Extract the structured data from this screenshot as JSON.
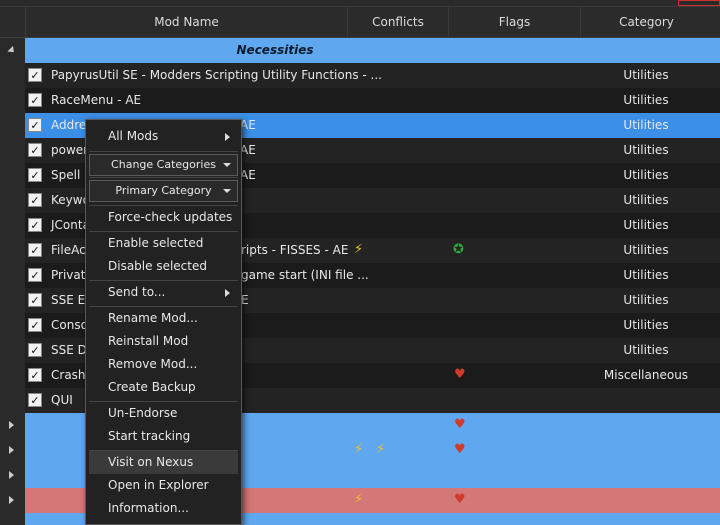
{
  "columns": {
    "mod_name": "Mod Name",
    "conflicts": "Conflicts",
    "flags": "Flags",
    "category": "Category"
  },
  "group": {
    "name": "Necessities"
  },
  "mods": [
    {
      "name": "PapyrusUtil SE - Modders Scripting Utility Functions - ...",
      "category": "Utilities"
    },
    {
      "name": "RaceMenu - AE",
      "category": "Utilities"
    },
    {
      "name": "Address Library for SKSE Plugins - AE",
      "visible_left": "Addre",
      "visible_right": "AE",
      "category": "Utilities"
    },
    {
      "name": "powerofthree's Papyrus Extender - AE",
      "visible_left": "power",
      "visible_right": "AE",
      "category": "Utilities"
    },
    {
      "name": "Spell Perk Item Distributor - AE",
      "visible_left": "Spell P",
      "visible_right": "AE",
      "category": "Utilities"
    },
    {
      "name": "Keyword Item Distributor",
      "visible_left": "Keywo",
      "visible_right": "",
      "category": "Utilities"
    },
    {
      "name": "JContainers",
      "visible_left": "JConta",
      "visible_right": "",
      "category": "Utilities"
    },
    {
      "name": "FileAccess Interface for Skyrim SE Scripts - FISSES - AE",
      "visible_left": "FileAc",
      "visible_right": "ripts - FISSES - AE",
      "category": "Utilities"
    },
    {
      "name": "Private Profile Redirector - game start (INI file ...",
      "visible_left": "Private",
      "visible_right": "game start (INI file ...",
      "category": "Utilities"
    },
    {
      "name": "SSE Engine Fixes - AE",
      "visible_left": "SSE En",
      "visible_right": "E",
      "category": "Utilities"
    },
    {
      "name": "Console Util",
      "visible_left": "Conso",
      "visible_right": "",
      "category": "Utilities"
    },
    {
      "name": "SSE Display Tweaks",
      "visible_left": "SSE Di",
      "visible_right": "",
      "category": "Utilities"
    },
    {
      "name": "Crash Logger",
      "visible_left": "Crash",
      "visible_right": "",
      "category": "Miscellaneous"
    },
    {
      "name": "QUI",
      "visible_left": "QUI",
      "visible_right": "",
      "category": ""
    }
  ],
  "context_menu": {
    "all_mods": "All Mods",
    "change_categories": "Change Categories",
    "primary_category": "Primary Category",
    "force_check": "Force-check updates",
    "enable_selected": "Enable selected",
    "disable_selected": "Disable selected",
    "send_to": "Send to...",
    "rename": "Rename Mod...",
    "reinstall": "Reinstall Mod",
    "remove": "Remove Mod...",
    "backup": "Create Backup",
    "unendorse": "Un-Endorse",
    "start_tracking": "Start tracking",
    "visit_nexus": "Visit on Nexus",
    "open_explorer": "Open in Explorer",
    "information": "Information..."
  },
  "icons": {
    "conflict": "lightning-icon",
    "flag_pin": "pin-icon",
    "flag_heart": "heart-icon",
    "check": "✓"
  },
  "colors": {
    "selected_row": "#3b8fe6",
    "group_band": "#5fa8f0",
    "pink_row": "#d47777",
    "background": "#1e1e1e"
  }
}
